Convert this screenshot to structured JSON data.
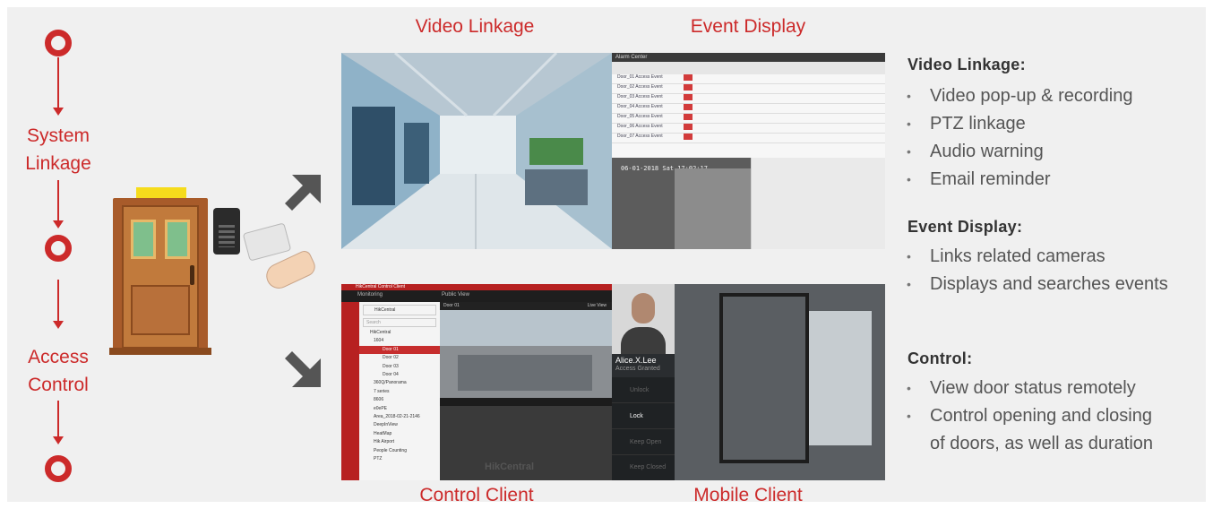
{
  "flow": {
    "label_system": "System\nLinkage",
    "label_access": "Access\nControl"
  },
  "captions": {
    "video_linkage": "Video Linkage",
    "event_display": "Event Display",
    "control_client": "Control Client",
    "mobile_client": "Mobile Client"
  },
  "screens": {
    "event_display": {
      "window_title": "Alarm Center",
      "rows": [
        "Door_01  Access Event",
        "Door_02  Access Event",
        "Door_03  Access Event",
        "Door_04  Access Event",
        "Door_05  Access Event",
        "Door_06  Access Event",
        "Door_07  Access Event"
      ],
      "video_overlay": "06-01-2018 Sat 17:02:17"
    },
    "control_client": {
      "app_title": "HikCentral Control Client",
      "tab_monitoring": "Monitoring",
      "tab_public_view": "Public View",
      "site_name": "HikCentral",
      "search_placeholder": "Search",
      "tree": [
        "HikCentral",
        "1604",
        "Door 01",
        "Door 02",
        "Door 03",
        "Door 04",
        "360Q/Panorama",
        "7 series",
        "8606",
        "e0ePE",
        "Area_2018-02-21-2146",
        "DeepInView",
        "HeatMap",
        "Hik Airport",
        "People Counting",
        "PTZ"
      ],
      "video_title": "Door 01",
      "live_view": "Live View",
      "watermark": "HikCentral"
    },
    "mobile_client": {
      "person_name": "Alice.X.Lee",
      "person_status": "Access Granted",
      "buttons": [
        "Unlock",
        "Lock",
        "Keep Open",
        "Keep Closed"
      ]
    }
  },
  "right_text": {
    "video_linkage_heading": "Video Linkage:",
    "video_linkage_items": [
      "Video pop-up & recording",
      "PTZ linkage",
      "Audio warning",
      "Email reminder"
    ],
    "event_display_heading": "Event Display:",
    "event_display_items": [
      "Links related cameras",
      "Displays and searches events"
    ],
    "control_heading": "Control:",
    "control_items": [
      "View door status remotely",
      "Control opening and closing of doors, as well as duration"
    ]
  },
  "colors": {
    "accent_red": "#cc2a2a",
    "panel_bg": "#f0f0f0",
    "heading_text": "#333333",
    "body_text": "#555555"
  }
}
